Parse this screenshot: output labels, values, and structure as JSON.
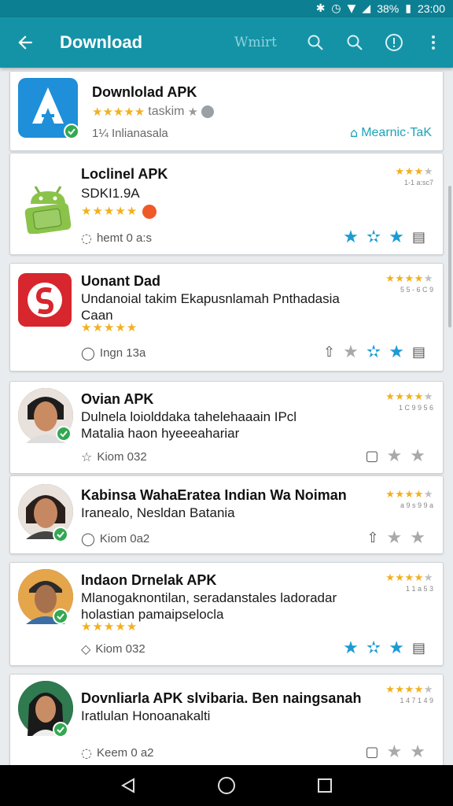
{
  "status_bar": {
    "battery": "38%",
    "time": "23:00"
  },
  "app_bar": {
    "title": "Download",
    "action_text": "Wmirt",
    "back_icon": "arrow-left-icon",
    "icons": [
      "search-icon",
      "search-icon",
      "info-icon",
      "more-vert-icon"
    ]
  },
  "colors": {
    "app_bar": "#1593a6",
    "status_bar": "#0d7f92",
    "star": "#f2b01e",
    "action_blue": "#1b9bd3",
    "verified": "#33a852"
  },
  "cards": [
    {
      "title": "Downlolad APK",
      "subtitle": "taskim",
      "meta": "1¼ Inlianasala",
      "badge": "Mearnic·TaK",
      "icon": "apk-store-logo"
    },
    {
      "title": "Loclinel APK",
      "line1": "SDKI1.9A",
      "meta": "hemt 0 a:s",
      "rating_count": "1-1 a:sc7",
      "icon": "android-logo"
    },
    {
      "title": "Uonant Dad",
      "line1": "Undanoial takim Ekapusnlamah Pnthadasia",
      "line2": "Caan",
      "meta": "Ingn 13a",
      "rating_count": "5 5 - 6 C 9",
      "icon": "red-s-logo"
    },
    {
      "title": "Ovian APK",
      "line1": "Dulnela loiolddaka tahelehaaain IPcl",
      "line2": "Matalia haon hyeeeahariar",
      "meta": "Kiom 032",
      "rating_count": "1 C 9 9 5 6",
      "icon": "avatar"
    },
    {
      "title": "Kabinsa WahaEratea Indian Wa Noiman",
      "line1": "Iranealo, Nesldan Batania",
      "meta": "Kiom 0a2",
      "rating_count": "a 9 s 9 9 a",
      "icon": "avatar"
    },
    {
      "title": "Indaon Drnelak APK",
      "line1": "Mlanogaknontilan, seradanstales ladoradar",
      "line2": "holastian pamaipselocla",
      "meta": "Kiom 032",
      "rating_count": "1 1 a 5 3",
      "icon": "avatar"
    },
    {
      "title": "Dovnliarla APK slvibaria. Ben naingsanah",
      "line1": "Iratlulan Honoanakalti",
      "meta": "Keem 0 a2",
      "rating_count": "1 4 7 1 4 9",
      "icon": "avatar"
    }
  ]
}
